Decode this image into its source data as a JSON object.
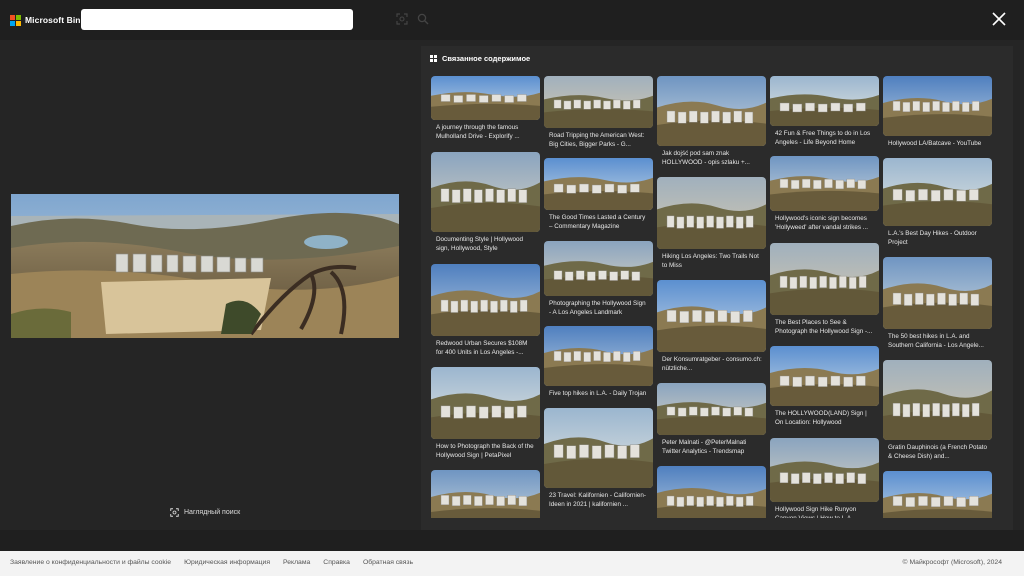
{
  "header": {
    "brand": "Microsoft Bing",
    "search_value": "",
    "search_placeholder": "",
    "brand_colors": [
      "#f25022",
      "#7fba00",
      "#00a4ef",
      "#ffb900"
    ]
  },
  "viewer": {
    "visual_search_label": "Наглядный поиск"
  },
  "related": {
    "heading": "Связанное содержимое",
    "cards": [
      {
        "caption": "A journey through the famous Mulholland Drive - Explorify ..."
      },
      {
        "caption": "Documenting Style | Hollywood sign, Hollywood, Style"
      },
      {
        "caption": "Redwood Urban Secures $108M for 400 Units in Los Angeles -..."
      },
      {
        "caption": "How to Photograph the Back of the Hollywood Sign | PetaPixel"
      },
      {
        "caption": ""
      },
      {
        "caption": "Road Tripping the American West: Big Cities, Bigger Parks - G..."
      },
      {
        "caption": "The Good Times Lasted a Century – Commentary Magazine"
      },
      {
        "caption": "Photographing the Hollywood Sign - A Los Angeles Landmark"
      },
      {
        "caption": "Five top hikes in L.A. - Daily Trojan"
      },
      {
        "caption": "23 Travel: Kalifornien - Californien-Ideen in 2021 | kalifornien ..."
      },
      {
        "caption": "Jak dojść pod sam znak HOLLYWOOD - opis szlaku +..."
      },
      {
        "caption": "Hiking Los Angeles: Two Trails Not to Miss"
      },
      {
        "caption": "Der Konsumratgeber - consumo.ch: nützliche..."
      },
      {
        "caption": "Peter Malnati - @PeterMalnati Twitter Analytics - Trendsmap"
      },
      {
        "caption": ""
      },
      {
        "caption": "42 Fun & Free Things to do in Los Angeles - Life Beyond Home"
      },
      {
        "caption": "Hollywood's iconic sign becomes 'Hollyweed' after vandal strikes ..."
      },
      {
        "caption": "The Best Places to See & Photograph the Hollywood Sign -..."
      },
      {
        "caption": "The HOLLYWOOD(LAND) Sign | On Location: Hollywood"
      },
      {
        "caption": "Hollywood Sign Hike Runyon Canyon Views | How to L.A."
      },
      {
        "caption": "Hollywood LA/Batcave - YouTube"
      },
      {
        "caption": "L.A.'s Best Day Hikes - Outdoor Project"
      },
      {
        "caption": "The 50 best hikes in L.A. and Southern California - Los Angele..."
      },
      {
        "caption": "Gratin Dauphinois (a French Potato & Cheese Dish) and..."
      },
      {
        "caption": ""
      }
    ]
  },
  "footer": {
    "links": [
      "Заявление о конфиденциальности и файлы cookie",
      "Юридическая информация",
      "Реклама",
      "Справка",
      "Обратная связь"
    ],
    "copyright": "© Майкрософт (Microsoft), 2024"
  }
}
